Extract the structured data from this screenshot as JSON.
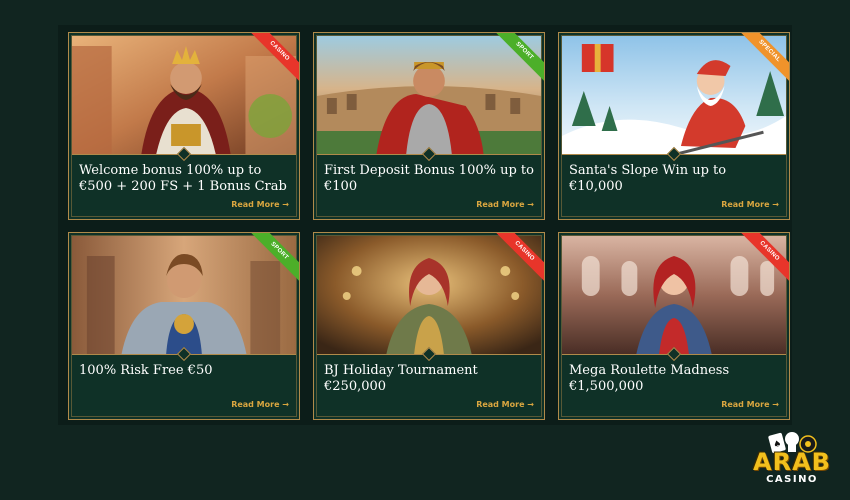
{
  "promotions": [
    {
      "title": "Welcome bonus 100% up to €500 + 200 FS + 1 Bonus Crab",
      "tag": "CASINO",
      "tag_color": "#e8352a",
      "read_more": "Read More →"
    },
    {
      "title": "First Deposit Bonus 100% up to €100",
      "tag": "SPORT",
      "tag_color": "#4caf29",
      "read_more": "Read More →"
    },
    {
      "title": "Santa's Slope Win up to €10,000",
      "tag": "SPECIAL",
      "tag_color": "#f0932b",
      "read_more": "Read More →"
    },
    {
      "title": "100% Risk Free €50",
      "tag": "SPORT",
      "tag_color": "#4caf29",
      "read_more": "Read More →"
    },
    {
      "title": "BJ Holiday Tournament €250,000",
      "tag": "CASINO",
      "tag_color": "#e8352a",
      "read_more": "Read More →"
    },
    {
      "title": "Mega Roulette Madness €1,500,000",
      "tag": "CASINO",
      "tag_color": "#e8352a",
      "read_more": "Read More →"
    }
  ],
  "logo": {
    "brand": "ARAB",
    "sub": "CASINO"
  },
  "colors": {
    "accent_gold": "#d9a640",
    "card_bg": "#0f3127",
    "page_bg": "#112520"
  }
}
